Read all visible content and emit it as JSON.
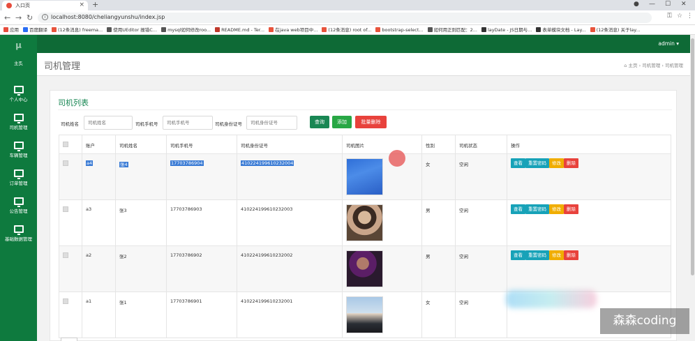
{
  "browser": {
    "tab_title": "入口页",
    "new_tab": "+",
    "url": "localhost:8080/cheliangyunshu/index.jsp",
    "bookmarks": [
      {
        "label": "应用",
        "color": "#e74c3c"
      },
      {
        "label": "百度翻译",
        "color": "#2a6df4"
      },
      {
        "label": "(12条消息) freema...",
        "color": "#e8543c"
      },
      {
        "label": "使用UEditor 报错C...",
        "color": "#555555"
      },
      {
        "label": "mysql如何修改roo...",
        "color": "#555555"
      },
      {
        "label": "README.md - Ter...",
        "color": "#c0392b"
      },
      {
        "label": "在java web项目中...",
        "color": "#e8543c"
      },
      {
        "label": "(12条消息) root of...",
        "color": "#e8543c"
      },
      {
        "label": "bootstrap-select...",
        "color": "#e8543c"
      },
      {
        "label": "如何用正则匹配：2...",
        "color": "#555555"
      },
      {
        "label": "layDate - JS日期与...",
        "color": "#333333"
      },
      {
        "label": "表单模块文档 - Lay...",
        "color": "#333333"
      },
      {
        "label": "(12条消息) 关于lay...",
        "color": "#e8543c"
      }
    ]
  },
  "app": {
    "logo": "μ",
    "user": "admin ▾",
    "sidebar": [
      {
        "label": "主页",
        "icon": "dashboard-icon"
      },
      {
        "label": "个人中心",
        "icon": "monitor-icon"
      },
      {
        "label": "司机管理",
        "icon": "monitor-icon"
      },
      {
        "label": "车辆管理",
        "icon": "monitor-icon"
      },
      {
        "label": "订单管理",
        "icon": "monitor-icon"
      },
      {
        "label": "公告管理",
        "icon": "monitor-icon"
      },
      {
        "label": "基础数据管理",
        "icon": "monitor-icon"
      }
    ]
  },
  "page": {
    "title": "司机管理",
    "breadcrumb": [
      "主页",
      "司机管理",
      "司机管理"
    ],
    "card_title": "司机列表"
  },
  "filters": {
    "name_label": "司机姓名",
    "name_placeholder": "司机姓名",
    "phone_label": "司机手机号",
    "phone_placeholder": "司机手机号",
    "idcard_label": "司机身份证号",
    "idcard_placeholder": "司机身份证号",
    "search": "查询",
    "add": "添加",
    "batch_delete": "批量删除"
  },
  "table": {
    "headers": [
      "",
      "账户",
      "司机姓名",
      "司机手机号",
      "司机身份证号",
      "司机图片",
      "性别",
      "司机状态",
      "操作"
    ],
    "actions": {
      "view": "查看",
      "reset": "重置密码",
      "edit": "修改",
      "delete": "删除"
    },
    "rows": [
      {
        "account": "a4",
        "name": "张4",
        "phone": "17703786904",
        "idcard": "410224199610232004",
        "gender": "女",
        "status": "空闲"
      },
      {
        "account": "a3",
        "name": "张3",
        "phone": "17703786903",
        "idcard": "410224199610232003",
        "gender": "男",
        "status": "空闲"
      },
      {
        "account": "a2",
        "name": "张2",
        "phone": "17703786902",
        "idcard": "410224199610232002",
        "gender": "男",
        "status": "空闲"
      },
      {
        "account": "a1",
        "name": "张1",
        "phone": "17703786901",
        "idcard": "410224199610232001",
        "gender": "女",
        "status": "空闲"
      }
    ]
  },
  "watermark": "森森coding",
  "colors": {
    "sidebar": "#0e7a3e",
    "topnav": "#0e6a36",
    "title": "#198754",
    "search": "#198754",
    "add": "#28a745",
    "danger": "#e8423c",
    "info": "#17a2b8",
    "warning": "#f0ad00"
  }
}
